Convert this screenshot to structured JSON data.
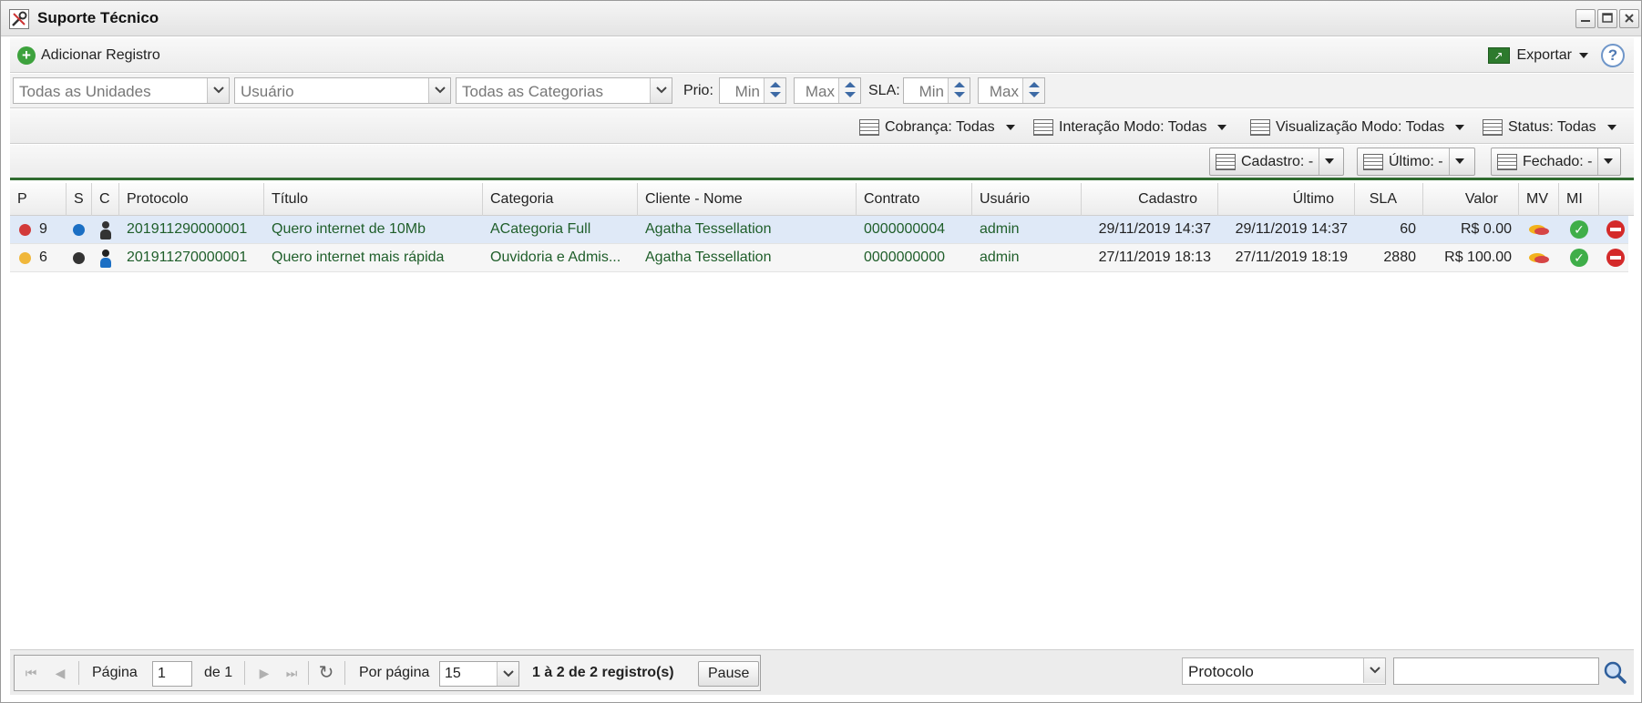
{
  "window": {
    "title": "Suporte Técnico",
    "icon": "tools-icon"
  },
  "toolbar": {
    "add_label": "Adicionar Registro",
    "export_label": "Exportar"
  },
  "filters": {
    "units_value": "Todas as Unidades",
    "user_placeholder": "Usuário",
    "categories_value": "Todas as Categorias",
    "prio_label": "Prio:",
    "prio_min_placeholder": "Min",
    "prio_max_placeholder": "Max",
    "sla_label": "SLA:",
    "sla_min_placeholder": "Min",
    "sla_max_placeholder": "Max"
  },
  "modes": {
    "cobranca": "Cobrança: Todas",
    "interacao": "Interação Modo: Todas",
    "visualizacao": "Visualização Modo: Todas",
    "status": "Status: Todas"
  },
  "date_filters": {
    "cadastro": "Cadastro: -",
    "ultimo": "Último: -",
    "fechado": "Fechado: -"
  },
  "grid": {
    "columns": [
      "P",
      "S",
      "C",
      "Protocolo",
      "Título",
      "Categoria",
      "Cliente - Nome",
      "Contrato",
      "Usuário",
      "Cadastro",
      "Último",
      "SLA",
      "Valor",
      "MV",
      "MI"
    ],
    "rows": [
      {
        "priority": "9",
        "priority_color": "#d23a3a",
        "status_color": "#1b6fc4",
        "client_type": "dark",
        "protocolo": "201911290000001",
        "titulo": "Quero internet de 10Mb",
        "categoria": "ACategoria Full",
        "cliente": "Agatha Tessellation",
        "contrato": "0000000004",
        "usuario": "admin",
        "cadastro": "29/11/2019 14:37",
        "ultimo": "29/11/2019 14:37",
        "sla": "60",
        "valor": "R$ 0.00"
      },
      {
        "priority": "6",
        "priority_color": "#f0b73a",
        "status_color": "#333333",
        "client_type": "blue",
        "protocolo": "201911270000001",
        "titulo": "Quero internet mais rápida",
        "categoria": "Ouvidoria e Admis...",
        "cliente": "Agatha Tessellation",
        "contrato": "0000000000",
        "usuario": "admin",
        "cadastro": "27/11/2019 18:13",
        "ultimo": "27/11/2019 18:19",
        "sla": "2880",
        "valor": "R$ 100.00"
      }
    ]
  },
  "paging": {
    "page_label": "Página",
    "page_value": "1",
    "of_label": "de 1",
    "per_page_label": "Por página",
    "per_page_value": "15",
    "summary": "1 à 2 de 2 registro(s)",
    "pause_label": "Pause",
    "search_field_value": "Protocolo",
    "search_input_value": ""
  }
}
